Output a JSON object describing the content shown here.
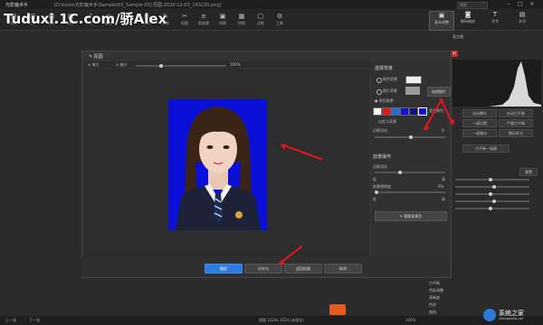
{
  "app": {
    "title": "光影魔术手",
    "file": "[D:\\tools\\光影魔术手\\Sample\\03_Sample 03] 原图:2020-12-03_163235.png]"
  },
  "watermark": "Tuduxi.1C.com/骄Alex",
  "search": {
    "placeholder": "搜索"
  },
  "toolbar": {
    "items": [
      {
        "label": "浏览",
        "icon": "folder-icon"
      },
      {
        "label": "打开",
        "icon": "open-icon"
      },
      {
        "label": "保存",
        "icon": "save-icon"
      },
      {
        "label": "另存",
        "icon": "save-as-icon"
      },
      {
        "label": "尺寸",
        "icon": "resize-icon"
      },
      {
        "label": "裁剪",
        "icon": "crop-icon"
      },
      {
        "label": "旋转",
        "icon": "rotate-icon"
      },
      {
        "label": "打印",
        "icon": "print-icon"
      },
      {
        "label": "画笔",
        "icon": "brush-icon"
      },
      {
        "label": "抠图",
        "icon": "cutout-icon"
      },
      {
        "label": "批处理",
        "icon": "batch-icon"
      },
      {
        "label": "排版",
        "icon": "layout-icon"
      },
      {
        "label": "拼图",
        "icon": "collage-icon"
      },
      {
        "label": "边框",
        "icon": "frame-icon"
      },
      {
        "label": "工具",
        "icon": "tools-icon"
      }
    ],
    "right_tabs": [
      {
        "label": "基本调整",
        "icon": "adjust-icon"
      },
      {
        "label": "数码暗房",
        "icon": "darkroom-icon"
      },
      {
        "label": "文字",
        "icon": "text-icon"
      },
      {
        "label": "水印",
        "icon": "watermark-icon"
      }
    ]
  },
  "dialog": {
    "title": "抠图",
    "toolbar_items": [
      "放大",
      "缩小",
      "100%"
    ],
    "side": {
      "section_fill": "选择背景",
      "bg_color_label": "纯色背景",
      "bg_image_label": "图片背景",
      "select_image_btn": "选择图片",
      "section_common": "常用背景",
      "swatches": [
        "#ffffff",
        "#e8141b",
        "#1e6fd9",
        "#0a10d8",
        "#101080"
      ],
      "picker_label": "更多颜色",
      "custom_label": "自定义背景",
      "edge_label": "边缘羽化",
      "edge_value": "0",
      "section_ops": "前景操作",
      "feather_label": "边缘羽化",
      "opacity_label": "前景透明度",
      "low": "低",
      "high": "高",
      "opacity_value": "0%",
      "replace_btn": "替换背景色"
    },
    "bottom": {
      "ok": "确定",
      "save_as": "另存为",
      "back": "返回抠图",
      "cancel": "取消"
    }
  },
  "rightpanel": {
    "tab_header": "直方图",
    "buttons": [
      [
        "自动曝光",
        "自动白平衡"
      ],
      [
        "一键设置",
        "严重白平衡"
      ],
      [
        "一键美化",
        "数码补光"
      ]
    ],
    "single_btn": "白平衡一指键",
    "reset": "重置",
    "list": [
      "白平衡",
      "色彩调整",
      "清晰度",
      "色阶",
      "曲线"
    ]
  },
  "statusbar": {
    "left": [
      "上一张",
      "下一张"
    ],
    "center": "原图 1024x 1024  (未保存)",
    "zoom": "100%"
  },
  "logo": {
    "text": "系统之家",
    "sub": "xitongzhijia.net"
  },
  "colors": {
    "accent": "#2f7de1",
    "photo_bg": "#0a10d8",
    "arrow": "#e8141b"
  }
}
